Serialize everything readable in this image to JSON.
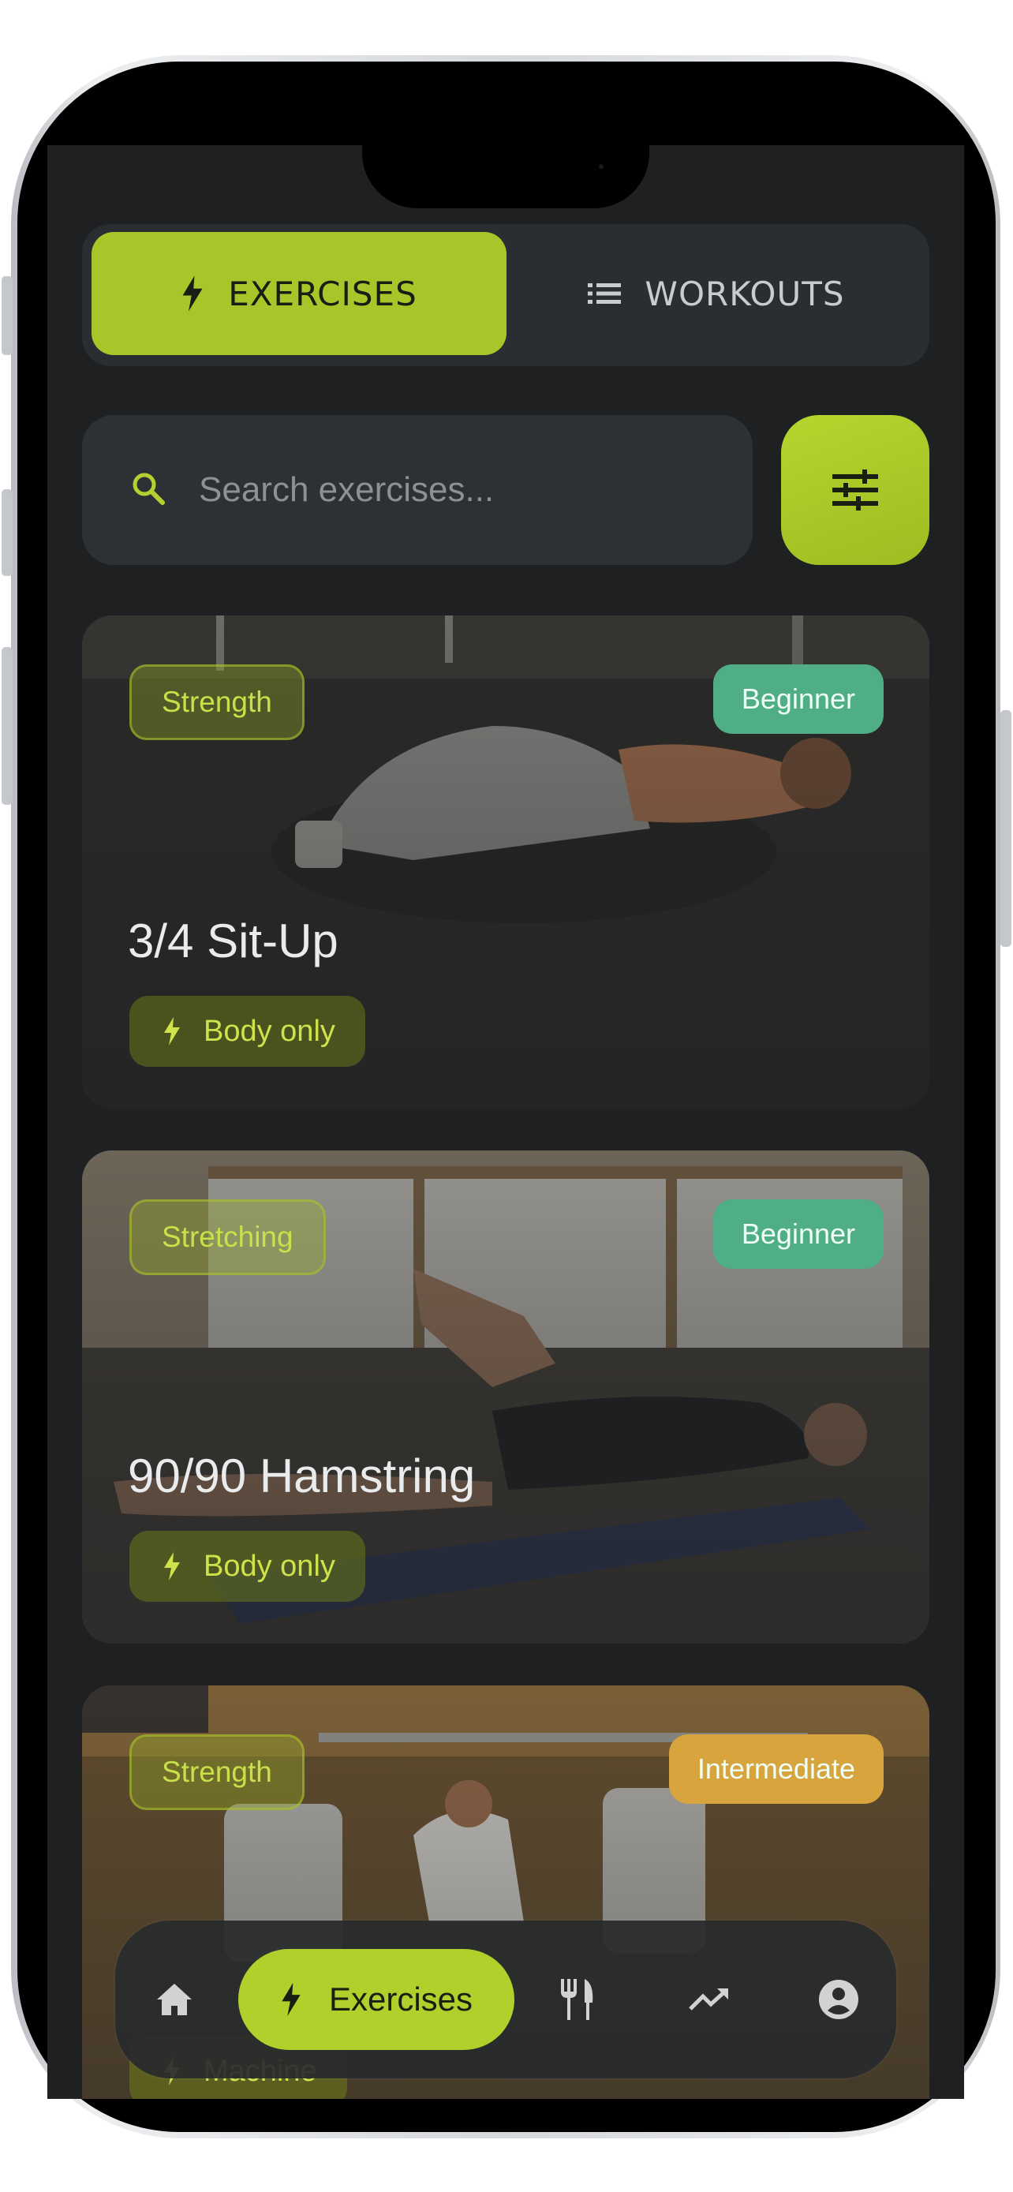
{
  "tabs": {
    "exercises_label": "EXERCISES",
    "workouts_label": "WORKOUTS"
  },
  "search": {
    "placeholder": "Search exercises..."
  },
  "exercises": [
    {
      "category": "Strength",
      "level": "Beginner",
      "name": "3/4 Sit-Up",
      "equipment": "Body only"
    },
    {
      "category": "Stretching",
      "level": "Beginner",
      "name": "90/90 Hamstring",
      "equipment": "Body only"
    },
    {
      "category": "Strength",
      "level": "Intermediate",
      "name": "",
      "equipment": "Machine"
    }
  ],
  "bottom_nav": {
    "items": [
      {
        "icon": "home-icon"
      },
      {
        "icon": "bolt-icon",
        "label": "Exercises"
      },
      {
        "icon": "utensils-icon"
      },
      {
        "icon": "trending-up-icon"
      },
      {
        "icon": "account-icon"
      }
    ]
  },
  "colors": {
    "accent": "#a7c62a",
    "background": "#1e2022",
    "beginner_badge": "#4fae86",
    "intermediate_badge": "#d7a43e"
  }
}
